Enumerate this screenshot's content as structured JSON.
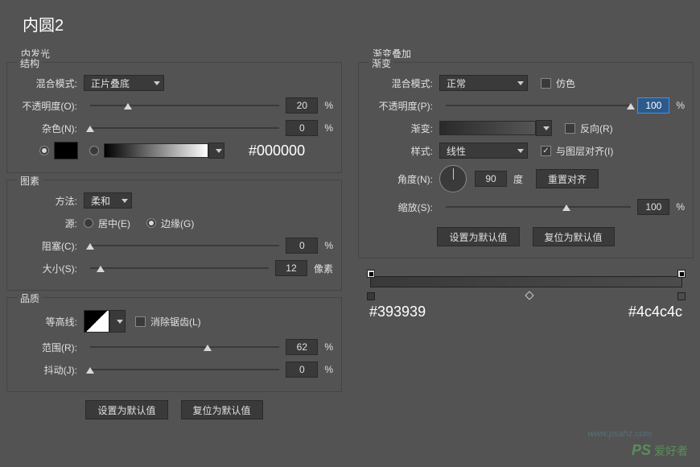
{
  "title": "内圆2",
  "innerGlow": {
    "sectionLabel": "内发光",
    "structure": {
      "groupLabel": "结构",
      "blendModeLabel": "混合模式:",
      "blendModeValue": "正片叠底",
      "opacityLabel": "不透明度(O):",
      "opacityValue": "20",
      "opacityUnit": "%",
      "noiseLabel": "杂色(N):",
      "noiseValue": "0",
      "noiseUnit": "%",
      "colorHex": "#000000"
    },
    "elements": {
      "groupLabel": "图素",
      "techniqueLabel": "方法:",
      "techniqueValue": "柔和",
      "sourceLabel": "源:",
      "sourceCenter": "居中(E)",
      "sourceEdge": "边缘(G)",
      "chokeLabel": "阻塞(C):",
      "chokeValue": "0",
      "chokeUnit": "%",
      "sizeLabel": "大小(S):",
      "sizeValue": "12",
      "sizeUnit": "像素"
    },
    "quality": {
      "groupLabel": "品质",
      "contourLabel": "等高线:",
      "antiAlias": "消除锯齿(L)",
      "rangeLabel": "范围(R):",
      "rangeValue": "62",
      "rangeUnit": "%",
      "jitterLabel": "抖动(J):",
      "jitterValue": "0",
      "jitterUnit": "%"
    },
    "makeDefault": "设置为默认值",
    "resetDefault": "复位为默认值"
  },
  "gradientOverlay": {
    "sectionLabel": "渐变叠加",
    "groupLabel": "渐变",
    "blendModeLabel": "混合模式:",
    "blendModeValue": "正常",
    "ditherLabel": "仿色",
    "opacityLabel": "不透明度(P):",
    "opacityValue": "100",
    "opacityUnit": "%",
    "gradientLabel": "渐变:",
    "reverseLabel": "反向(R)",
    "styleLabel": "样式:",
    "styleValue": "线性",
    "alignLabel": "与图层对齐(I)",
    "angleLabel": "角度(N):",
    "angleValue": "90",
    "angleUnit": "度",
    "resetAlign": "重置对齐",
    "scaleLabel": "缩放(S):",
    "scaleValue": "100",
    "scaleUnit": "%",
    "makeDefault": "设置为默认值",
    "resetDefault": "复位为默认值",
    "stopLeft": "#393939",
    "stopRight": "#4c4c4c"
  },
  "watermark": {
    "site": "www.psahz.com",
    "brand": "PS 爱好者"
  }
}
